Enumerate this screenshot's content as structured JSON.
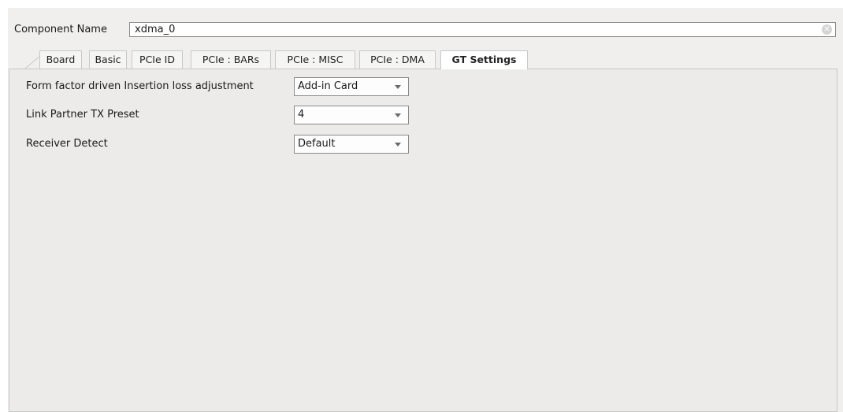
{
  "component": {
    "label": "Component Name",
    "value": "xdma_0"
  },
  "tabs": [
    {
      "label": "Board",
      "active": false
    },
    {
      "label": "Basic",
      "active": false
    },
    {
      "label": "PCIe ID",
      "active": false
    },
    {
      "label": "PCIe : BARs",
      "active": false
    },
    {
      "label": "PCIe : MISC",
      "active": false
    },
    {
      "label": "PCIe : DMA",
      "active": false
    },
    {
      "label": "GT Settings",
      "active": true
    }
  ],
  "settings": [
    {
      "label": "Form factor driven Insertion loss adjustment",
      "value": "Add-in Card"
    },
    {
      "label": "Link Partner TX Preset",
      "value": "4"
    },
    {
      "label": "Receiver Detect",
      "value": "Default"
    }
  ],
  "icons": {
    "clear": "clear-icon",
    "dropdown": "chevron-down-icon"
  }
}
